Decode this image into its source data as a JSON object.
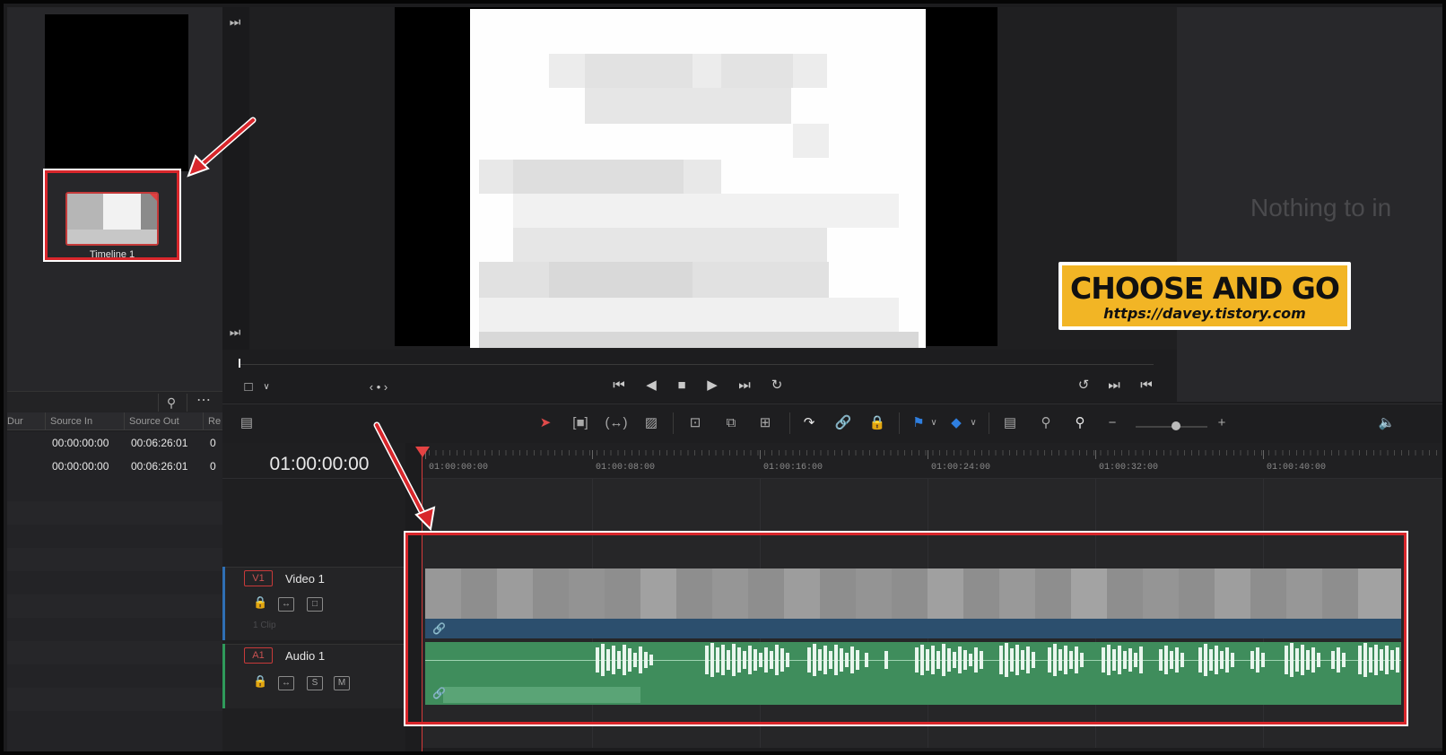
{
  "media_pool": {
    "thumbnail_label": "Timeline 1",
    "columns": [
      "Dur",
      "Source In",
      "Source Out",
      "Re"
    ],
    "rows": [
      {
        "source_in": "00:00:00:00",
        "source_out": "00:06:26:01",
        "extra": "0"
      },
      {
        "source_in": "00:00:00:00",
        "source_out": "00:06:26:01",
        "extra": "0"
      }
    ]
  },
  "viewer": {
    "empty_message": "Nothing to in",
    "jog_indicator": "‹ • ›"
  },
  "watermark": {
    "title": "CHOOSE AND GO",
    "url": "https://davey.tistory.com",
    "color": "#f2b525"
  },
  "timeline": {
    "timecode": "01:00:00:00",
    "ruler_labels": [
      "01:00:00:00",
      "01:00:08:00",
      "01:00:16:00",
      "01:00:24:00",
      "01:00:32:00",
      "01:00:40:00"
    ],
    "tracks": [
      {
        "tag": "V1",
        "name": "Video 1",
        "clip_count": "1 Clip"
      },
      {
        "tag": "A1",
        "name": "Audio 1",
        "solo": "S",
        "mute": "M"
      }
    ]
  },
  "colors": {
    "highlight": "#d8262b",
    "video_clip": "#8e8e8e",
    "video_bar": "#2c4f6e",
    "audio_clip": "#3f8d5c",
    "playhead": "#e44343"
  }
}
